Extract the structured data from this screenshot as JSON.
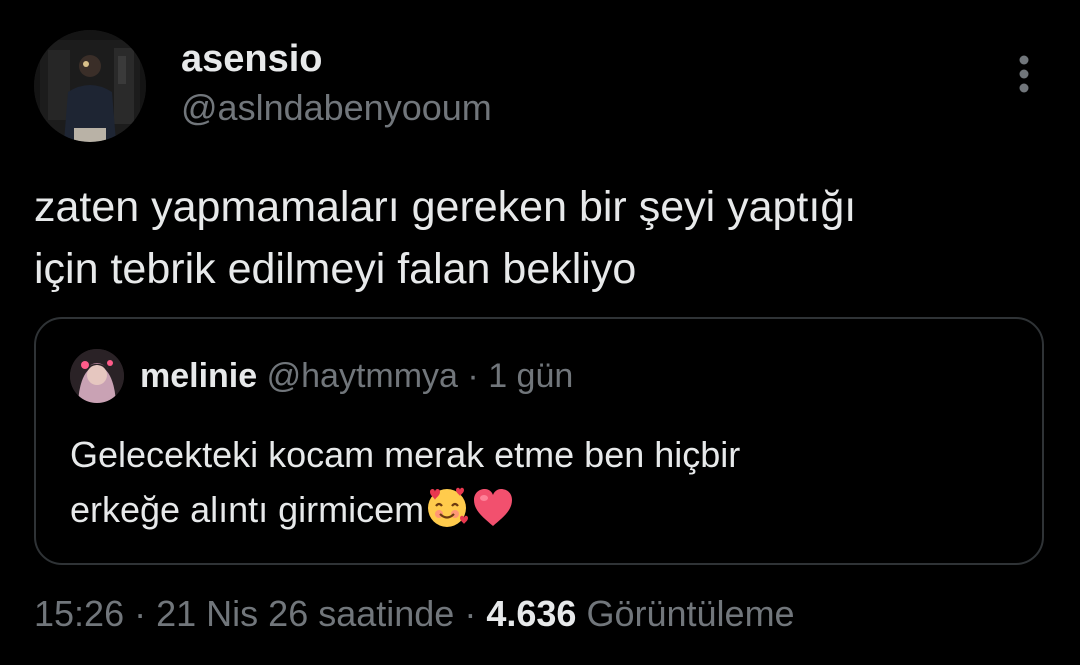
{
  "author": {
    "display_name": "asensio",
    "handle": "@aslndabenyooum",
    "avatar": "profile-photo"
  },
  "menu_icon": "more-vertical-icon",
  "tweet": {
    "lines": [
      "zaten yapmamaları gereken bir şeyi yaptığı",
      "için tebrik edilmeyi falan bekliyo"
    ]
  },
  "quote": {
    "display_name": "melinie",
    "handle": "@haytmmya",
    "separator": "·",
    "time": "1 gün",
    "lines": [
      "Gelecekteki kocam merak etme ben hiçbir",
      "erkeğe alıntı girmicem"
    ],
    "emojis": [
      "smiling-face-with-hearts-icon",
      "red-heart-icon"
    ]
  },
  "meta": {
    "time": "15:26",
    "sep1": "·",
    "date": "21 Nis 26 saatinde",
    "sep2": "·",
    "views_count": "4.636",
    "views_label": "Görüntüleme"
  },
  "colors": {
    "background": "#000000",
    "primary_text": "#e7e9ea",
    "secondary_text": "#71767b",
    "border": "#2f3336"
  }
}
